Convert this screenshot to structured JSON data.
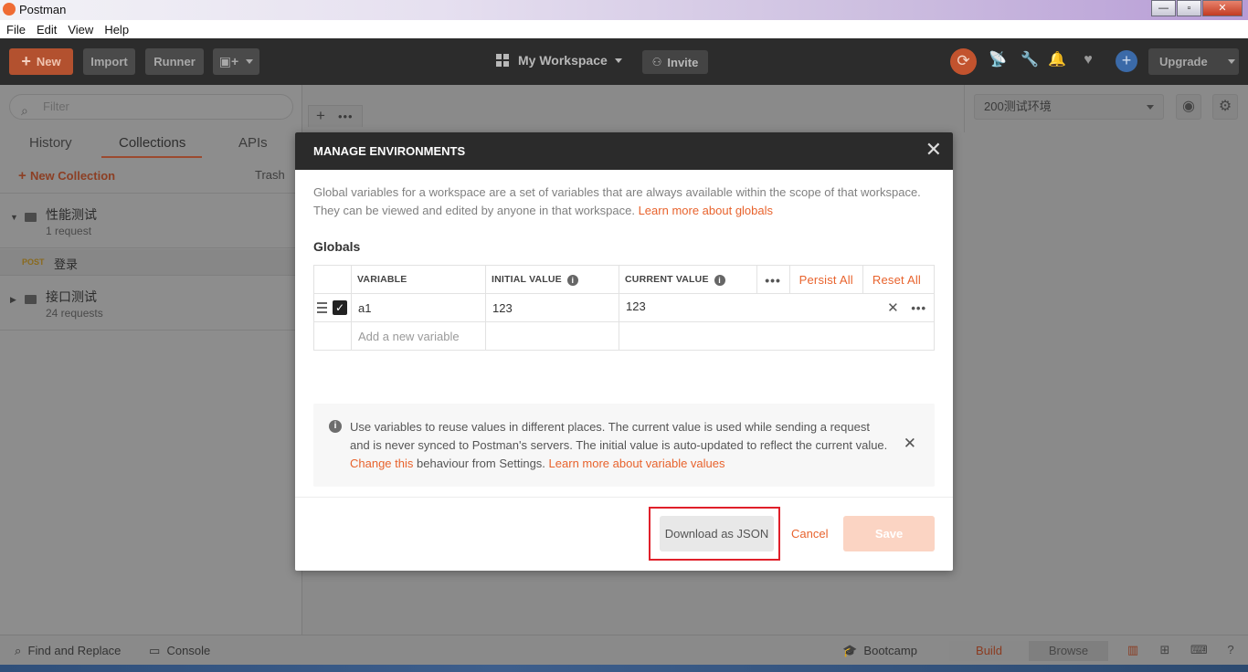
{
  "window": {
    "title": "Postman",
    "controls": [
      "—",
      "▫",
      "✕"
    ]
  },
  "menubar": [
    "File",
    "Edit",
    "View",
    "Help"
  ],
  "header": {
    "new_label": "New",
    "import_label": "Import",
    "runner_label": "Runner",
    "workspace_label": "My Workspace",
    "invite_label": "Invite",
    "upgrade_label": "Upgrade"
  },
  "sidebar": {
    "filter_placeholder": "Filter",
    "tabs": [
      "History",
      "Collections",
      "APIs"
    ],
    "active_tab": "Collections",
    "new_collection_label": "New Collection",
    "trash_label": "Trash",
    "collections": [
      {
        "name": "性能测试",
        "count": "1 request",
        "expanded": true
      },
      {
        "name": "接口测试",
        "count": "24 requests",
        "expanded": false
      }
    ],
    "request": {
      "method": "POST",
      "name": "登录"
    }
  },
  "environment": {
    "selected": "200测试环境"
  },
  "modal": {
    "title": "MANAGE ENVIRONMENTS",
    "description": "Global variables for a workspace are a set of variables that are always available within the scope of that workspace. They can be viewed and edited by anyone in that workspace.",
    "description_link": "Learn more about globals",
    "section_label": "Globals",
    "columns": {
      "variable": "VARIABLE",
      "initial": "INITIAL VALUE",
      "current": "CURRENT VALUE"
    },
    "persist_all": "Persist All",
    "reset_all": "Reset All",
    "rows": [
      {
        "variable": "a1",
        "initial": "123",
        "current": "123",
        "enabled": true
      }
    ],
    "add_placeholder": "Add a new variable",
    "notice": {
      "text_1": "Use variables to reuse values in different places. The current value is used while sending a request and is never synced to Postman's servers. The initial value is auto-updated to reflect the current value.",
      "link_1": "Change this",
      "text_2": "behaviour from Settings.",
      "link_2": "Learn more about variable values"
    },
    "download_label": "Download as JSON",
    "cancel_label": "Cancel",
    "save_label": "Save"
  },
  "statusbar": {
    "find_replace": "Find and Replace",
    "console": "Console",
    "bootcamp": "Bootcamp",
    "build": "Build",
    "browse": "Browse"
  },
  "colors": {
    "accent": "#e8632d",
    "header_bg": "#2c2c2c",
    "modal_head_bg": "#2b2b2b",
    "highlight": "#e0202a"
  }
}
